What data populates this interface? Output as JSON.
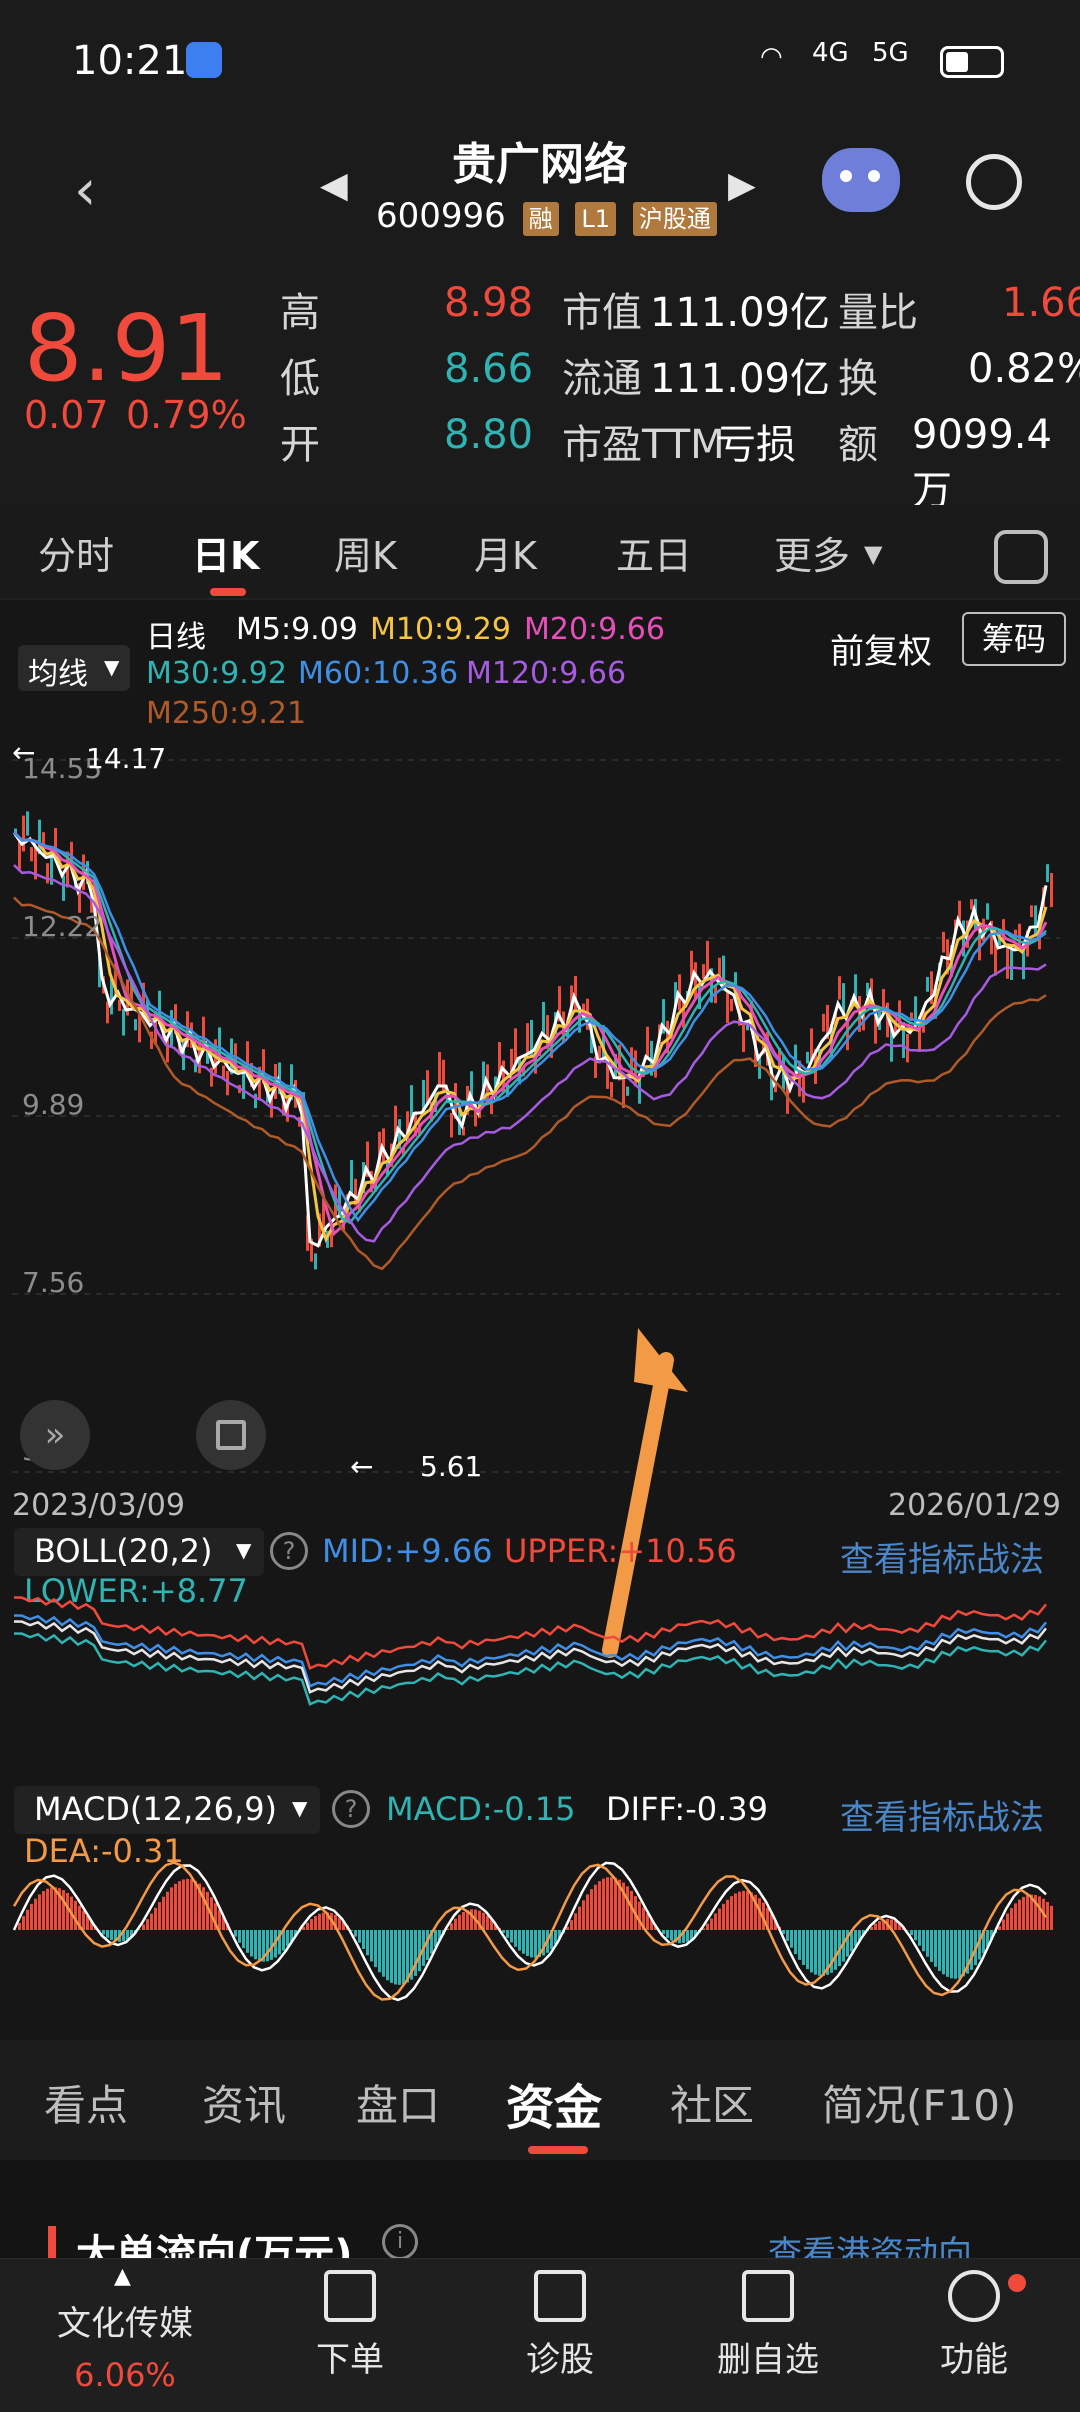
{
  "status_bar": {
    "time": "10:21",
    "network1": "4G",
    "network2": "5G"
  },
  "header": {
    "title": "贵广网络",
    "code": "600996",
    "tags": [
      "融",
      "L1",
      "沪股通"
    ]
  },
  "quote": {
    "price": "8.91",
    "change": "0.07",
    "change_pct": "0.79%",
    "rows": [
      {
        "label": "高",
        "value": "8.98",
        "label2": "市值",
        "value2": "111.09亿",
        "label3": "量比",
        "value3": "1.66"
      },
      {
        "label": "低",
        "value": "8.66",
        "label2": "流通",
        "value2": "111.09亿",
        "label3": "换",
        "value3": "0.82%"
      },
      {
        "label": "开",
        "value": "8.80",
        "label2": "市盈TTM",
        "value2": "亏损",
        "label3": "额",
        "value3": "9099.4万"
      }
    ]
  },
  "tabs": [
    "分时",
    "日K",
    "周K",
    "月K",
    "五日",
    "更多"
  ],
  "ma": {
    "toggle": "均线",
    "line_label": "日线",
    "m5": "M5:9.09",
    "m10": "M10:9.29",
    "m20": "M20:9.66",
    "m30": "M30:9.92",
    "m60": "M60:10.36",
    "m120": "M120:9.66",
    "m250": "M250:9.21",
    "adjust": "前复权",
    "chips": "筹码"
  },
  "chart": {
    "y_ticks": [
      "14.55",
      "12.22",
      "9.89",
      "7.56",
      "5.23"
    ],
    "high_label": "14.17",
    "low_label": "5.61",
    "date_start": "2023/03/09",
    "date_end": "2026/01/29"
  },
  "boll": {
    "name": "BOLL(20,2)",
    "mid": "MID:+9.66",
    "upper": "UPPER:+10.56",
    "lower": "LOWER:+8.77",
    "link": "查看指标战法"
  },
  "macd": {
    "name": "MACD(12,26,9)",
    "macd": "MACD:-0.15",
    "diff": "DIFF:-0.39",
    "dea": "DEA:-0.31",
    "link": "查看指标战法"
  },
  "bottom_tabs": [
    "看点",
    "资讯",
    "盘口",
    "资金",
    "社区",
    "简况(F10)"
  ],
  "section": {
    "title": "大单流向(万元)",
    "link": "查看港资动向"
  },
  "dock": {
    "sector_name": "文化传媒",
    "sector_change": "6.06%",
    "items": [
      "下单",
      "诊股",
      "删自选",
      "功能"
    ]
  },
  "colors": {
    "red": "#ef4a3c",
    "teal": "#2fb3b3",
    "orange": "#f39a46",
    "blue": "#4a86c8"
  }
}
